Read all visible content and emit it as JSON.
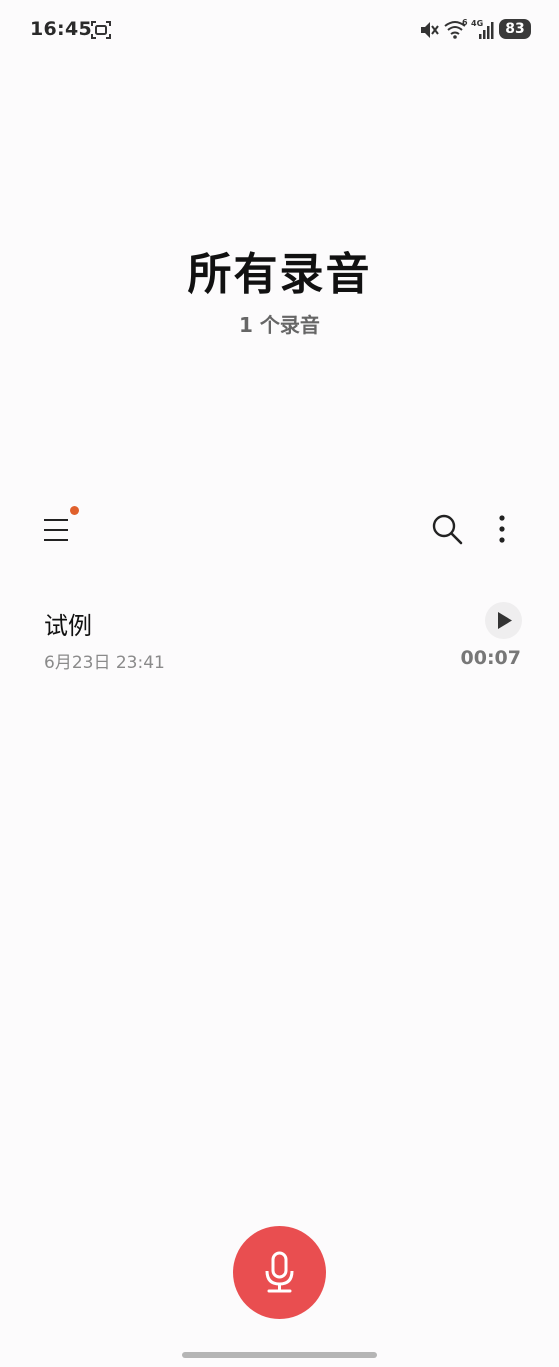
{
  "status_bar": {
    "time": "16:45",
    "battery": "83",
    "network": "4G",
    "wifi_badge": "6"
  },
  "header": {
    "title": "所有录音",
    "subtitle": "1 个录音"
  },
  "colors": {
    "accent": "#e94e50",
    "notify_dot": "#e0602c",
    "background": "#fcfbfc"
  },
  "recordings": [
    {
      "name": "试例",
      "date": "6月23日 23:41",
      "duration": "00:07"
    }
  ],
  "icons": {
    "menu": "menu-icon",
    "search": "search-icon",
    "more": "more-vertical-icon",
    "play": "play-icon",
    "record": "microphone-icon"
  }
}
